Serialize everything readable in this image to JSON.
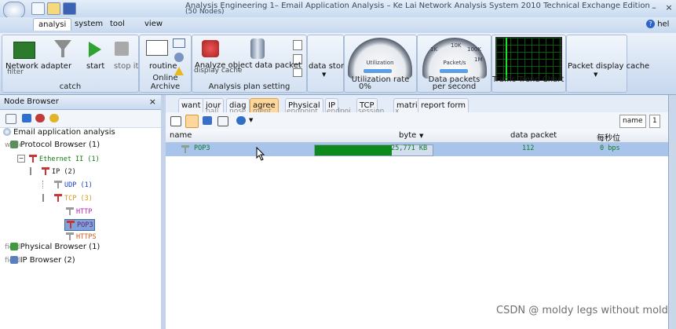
{
  "window": {
    "title": "Analysis Engineering 1– Email Application Analysis – Ke Lai Network Analysis System 2010 Technical Exchange Edition",
    "subtitle": "(50 Nodes)",
    "minimize": "–",
    "close": "×",
    "help": "hel"
  },
  "menu": {
    "items": [
      {
        "label": "analysi"
      },
      {
        "label": "system"
      },
      {
        "label": "tool"
      },
      {
        "label": "view"
      }
    ]
  },
  "ribbon": {
    "catch": {
      "network_adapter": "Network adapter",
      "network_adapter_ghost": "filter",
      "start": "start",
      "stop": "stop it",
      "group_label": "catch"
    },
    "routine": {
      "button": "routine",
      "group_label": "Online Archive"
    },
    "analysis": {
      "analyze_object": "Analyze object data packet",
      "display_cache": "display cache",
      "group_label": "Analysis plan setting"
    },
    "data_storage": "data storage",
    "utilization": {
      "label": "Utilization rate",
      "gauge_caption": "Utilization",
      "value": "0%"
    },
    "data_packets": {
      "label": "Data packets",
      "gauge_caption": "Packet/s",
      "value": "per second",
      "ticks": [
        "1K",
        "10K",
        "100K",
        "1M"
      ]
    },
    "trend": {
      "label": "Traffic Trend Chart (Bit)"
    },
    "packet_display_cache": "Packet display cache"
  },
  "sidebar": {
    "title": "Node Browser",
    "close": "×",
    "tree": [
      {
        "label": "Email application analysis",
        "ghost": ""
      },
      {
        "label": "Protocol Browser (1)",
        "ghost": "while"
      },
      {
        "label": "Ethernet II (1)",
        "ghost": ""
      },
      {
        "label": "IP (2)",
        "ghost": ""
      },
      {
        "label": "UDP (1)",
        "ghost": ""
      },
      {
        "label": "TCP (3)",
        "ghost": ""
      },
      {
        "label": "HTTP",
        "ghost": ""
      },
      {
        "label": "POP3",
        "ghost": ""
      },
      {
        "label": "HTTPS",
        "ghost": ""
      },
      {
        "label": "Physical Browser (1)",
        "ghost": "field"
      },
      {
        "label": "IP Browser (2)",
        "ghost": "field"
      }
    ]
  },
  "main": {
    "tabs": [
      {
        "label": "want",
        "ghost": ""
      },
      {
        "label": "jour",
        "ghost": "nall"
      },
      {
        "label": "diag",
        "ghost": "nose"
      },
      {
        "label": "agree",
        "ghost": "ment"
      },
      {
        "label": "Physical",
        "ghost": "endpoint"
      },
      {
        "label": "IP",
        "ghost": "endpoi"
      },
      {
        "label": "TCP",
        "ghost": "session"
      },
      {
        "label": "matri",
        "ghost": "x"
      },
      {
        "label": "report form",
        "ghost": ""
      }
    ],
    "pager": {
      "name": "name",
      "page": "1"
    },
    "columns": [
      "name",
      "byte",
      "data packet",
      "每秒位"
    ],
    "rows": [
      {
        "name": "POP3",
        "bytes": "25,771 KB",
        "bytes_fraction": 0.65,
        "packets": "112",
        "bps": "0 bps"
      }
    ]
  },
  "watermark": "CSDN @ moldy legs without mold"
}
